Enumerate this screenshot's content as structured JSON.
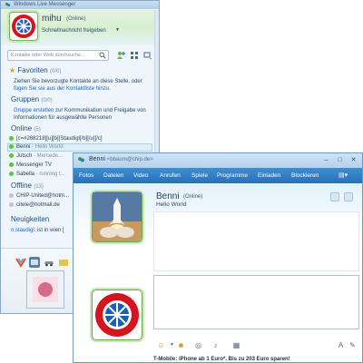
{
  "main_window": {
    "title": "Windows Live Messenger",
    "user": {
      "name": "mihu",
      "status": "(Online)",
      "personal_message": "Schnellnachricht freigeben"
    },
    "search_placeholder": "Kontakte oder Web durchsuche...",
    "favorites": {
      "title": "Favoriten",
      "count": "(0/0)",
      "text1": "Ziehen Sie bevorzugte Kontakte an diese Stelle, oder",
      "text2": "fügen Sie sie aus der Kontaktliste hinzu."
    },
    "groups": {
      "title": "Gruppen",
      "count": "(0/0)",
      "link": "Gruppe erstellen",
      "text1": " zur Kommunikation und Freigabe von",
      "text2": "Informationen für ausgewählte Personen"
    },
    "online": {
      "title": "Online",
      "count": "(5)",
      "contacts": [
        {
          "name": "[c=#268218][u][b][Staudigl[/b][/u][/c]",
          "sub": ""
        },
        {
          "name": "Benni",
          "sub": " - Hello World"
        },
        {
          "name": "Jutsch",
          "sub": " - Mercede..."
        },
        {
          "name": "Messenger TV",
          "sub": ""
        },
        {
          "name": "Sabella",
          "sub": " - running t..."
        }
      ]
    },
    "offline": {
      "title": "Offline",
      "count": "(13)",
      "contacts": [
        {
          "name": "CHIP-United@hotm..."
        },
        {
          "name": "citele@hotmail.de"
        }
      ]
    },
    "news": {
      "title": "Neuigkeiten",
      "item_user": "n.staudigl",
      "item_text": ": ist in wien ["
    }
  },
  "chat_window": {
    "title_name": "Benni",
    "title_email": "<bbaum@chip.de>",
    "menu": [
      "Fotos",
      "Dateien",
      "Video",
      "Anrufen",
      "Spiele",
      "Programme",
      "Einladen",
      "Blockieren"
    ],
    "contact": {
      "name": "Benni",
      "status": "(Online)",
      "message": "Hello World"
    },
    "ad_text": "T-Mobile: iPhone ab 1 Euro*. Bis zu 203 Euro sparen!"
  },
  "icons": {
    "brand_logo": "fc-bayern-logo",
    "contact_avatar": "space-shuttle-launch"
  },
  "colors": {
    "menu_bar": "#2a6fb7",
    "online_dot": "#5fc238",
    "link": "#1a62c7"
  }
}
